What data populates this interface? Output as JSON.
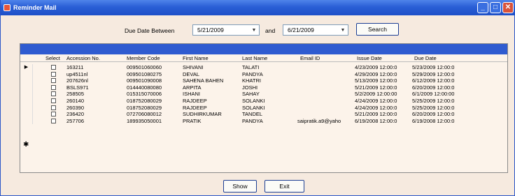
{
  "window": {
    "title": "Reminder Mail",
    "minimize_label": "_",
    "maximize_label": "□",
    "close_label": "✕"
  },
  "filter": {
    "due_date_label": "Due Date  Between",
    "from_date": "5/21/2009",
    "and_label": "and",
    "to_date": "6/21/2009",
    "search_label": "Search"
  },
  "grid": {
    "columns": [
      "Select",
      "Accession No.",
      "Member Code",
      "First Name",
      "Last Name",
      "Email ID",
      "Issue Date",
      "Due Date"
    ],
    "current_row_marker": "▶",
    "new_row_marker": "✱",
    "rows": [
      {
        "accession": "163211",
        "member": "009501060060",
        "first": "SHIVANI",
        "last": "TALATI",
        "email": "",
        "issue": "4/23/2009 12:00:0",
        "due": "5/23/2009 12:00:0"
      },
      {
        "accession": "up4511nl",
        "member": "009501080275",
        "first": "DEVAL",
        "last": "PANDYA",
        "email": "",
        "issue": "4/29/2009 12:00:0",
        "due": "5/29/2009 12:00:0"
      },
      {
        "accession": "207626nl",
        "member": "009501090008",
        "first": "SAHENA BAHEN",
        "last": "KHATRI",
        "email": "",
        "issue": "5/13/2009 12:00:0",
        "due": "6/12/2009 12:00:0"
      },
      {
        "accession": "BSLS971",
        "member": "014440080080",
        "first": "ARPITA",
        "last": "JOSHI",
        "email": "",
        "issue": "5/21/2009 12:00:0",
        "due": "6/20/2009 12:00:0"
      },
      {
        "accession": "258505",
        "member": "015315070006",
        "first": "ISHANI",
        "last": "SAHAY",
        "email": "",
        "issue": "5/2/2009 12:00:00",
        "due": "6/1/2009 12:00:00"
      },
      {
        "accession": "260140",
        "member": "018752080029",
        "first": "RAJDEEP",
        "last": "SOLANKI",
        "email": "",
        "issue": "4/24/2009 12:00:0",
        "due": "5/25/2009 12:00:0"
      },
      {
        "accession": "260390",
        "member": "018752080029",
        "first": "RAJDEEP",
        "last": "SOLANKI",
        "email": "",
        "issue": "4/24/2009 12:00:0",
        "due": "5/25/2009 12:00:0"
      },
      {
        "accession": "236420",
        "member": "072706080012",
        "first": "SUDHIRKUMAR",
        "last": "TANDEL",
        "email": "",
        "issue": "5/21/2009 12:00:0",
        "due": "6/20/2009 12:00:0"
      },
      {
        "accession": "257706",
        "member": "189935050001",
        "first": "PRATIK",
        "last": "PANDYA",
        "email": "saipratik.a9@yaho",
        "issue": "6/19/2008 12:00:0",
        "due": "6/19/2008 12:00:0"
      }
    ]
  },
  "actions": {
    "show_label": "Show",
    "exit_label": "Exit"
  }
}
